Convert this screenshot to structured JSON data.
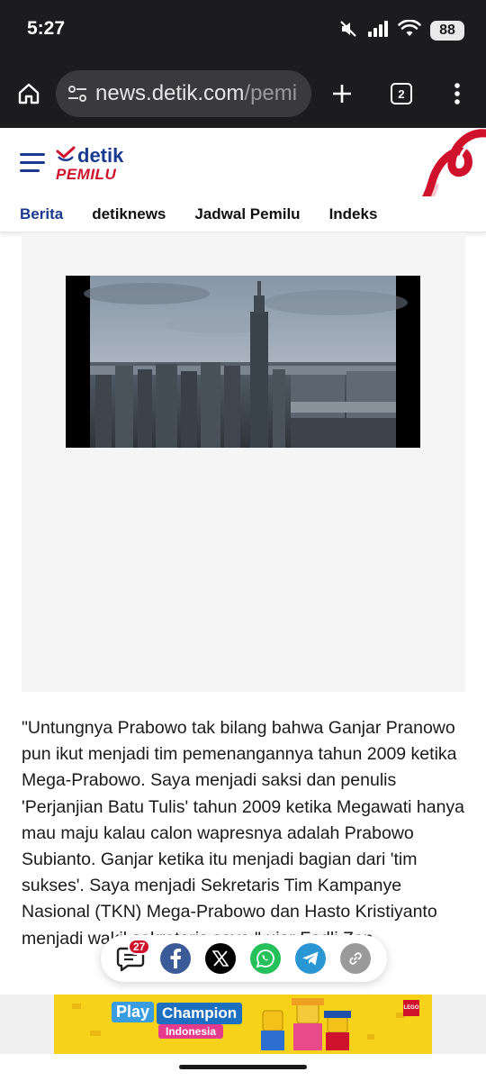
{
  "status_bar": {
    "time": "5:27",
    "battery": "88"
  },
  "browser": {
    "url_host": "news.detik.com",
    "url_path": "/pemi",
    "tab_count": "2"
  },
  "site": {
    "logo_text": "detik",
    "logo_subtext": "PEMILU",
    "nav_items": [
      "Berita",
      "detiknews",
      "Jadwal Pemilu",
      "Indeks"
    ]
  },
  "article": {
    "paragraph": "\"Untungnya Prabowo tak bilang bahwa Ganjar Pranowo pun ikut menjadi tim pemenangannya tahun 2009 ketika Mega-Prabowo. Saya menjadi saksi dan penulis 'Perjanjian Batu Tulis' tahun 2009 ketika Megawati hanya mau maju kalau calon wapresnya adalah Prabowo Subianto. Ganjar ketika itu menjadi bagian dari 'tim sukses'. Saya menjadi Sekretaris Tim Kampanye Nasional (TKN) Mega-Prabowo dan Hasto Kristiyanto menjadi wakil sekretaris saya,\" ujar Fadli Zon."
  },
  "share_bar": {
    "comment_count": "27",
    "buttons": [
      "comment-icon",
      "facebook-icon",
      "x-icon",
      "whatsapp-icon",
      "telegram-icon",
      "link-icon"
    ]
  },
  "ad": {
    "play_label": "Play",
    "champion_label": "Champion",
    "country_label": "Indonesia",
    "brand": "LEGO"
  },
  "colors": {
    "brand_blue": "#1a3a8f",
    "brand_red": "#d0112b",
    "browser_dark": "#1c1c1e"
  }
}
